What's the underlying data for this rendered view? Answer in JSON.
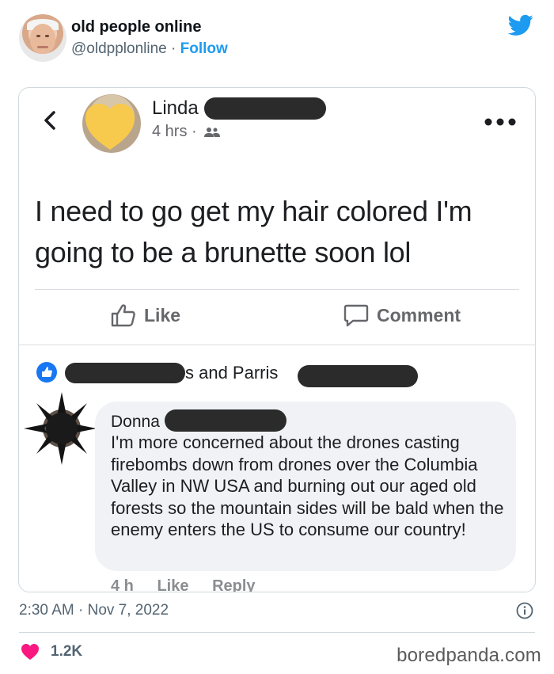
{
  "tweet": {
    "display_name": "old people online",
    "handle": "@oldpplonline",
    "separator": "·",
    "follow_label": "Follow",
    "timestamp": "2:30 AM · Nov 7, 2022",
    "like_count": "1.2K",
    "watermark": "boredpanda.com",
    "accent_color": "#1d9bf0",
    "heart_color": "#f91880"
  },
  "fb_post": {
    "author": "Linda",
    "time": "4 hrs",
    "dot": "·",
    "audience_icon": "friends-icon",
    "text": "I need to go get my hair colored I'm going to be a brunette soon lol",
    "like_label": "Like",
    "comment_label": "Comment",
    "reactors_text": "s and Parris",
    "reaction_color": "#1877f2"
  },
  "comment": {
    "author": "Donna",
    "text": "I'm more concerned about the drones casting firebombs down from drones over the Columbia Valley in NW USA and burning out our aged old forests so the mountain sides will be bald when the enemy enters the US to consume our country!",
    "time": "4 h",
    "like_label": "Like",
    "reply_label": "Reply"
  }
}
